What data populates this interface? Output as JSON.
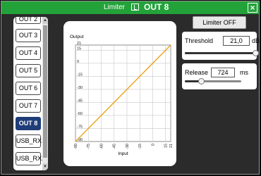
{
  "titlebar": {
    "label": "Limiter",
    "channel": "OUT 8",
    "close_icon": "×"
  },
  "channels": [
    {
      "label": "OUT 2",
      "active": false
    },
    {
      "label": "OUT 3",
      "active": false
    },
    {
      "label": "OUT 4",
      "active": false
    },
    {
      "label": "OUT 5",
      "active": false
    },
    {
      "label": "OUT 6",
      "active": false
    },
    {
      "label": "OUT 7",
      "active": false
    },
    {
      "label": "OUT 8",
      "active": true
    },
    {
      "label": "USB_RX1",
      "active": false
    },
    {
      "label": "USB_RX2",
      "active": false
    }
  ],
  "limiter_button": {
    "label": "Limiter OFF"
  },
  "threshold": {
    "label": "Threshold",
    "value": "21,0",
    "unit": "dBu",
    "fraction": 1.0
  },
  "release": {
    "label": "Release",
    "value": "724",
    "unit": "ms",
    "fraction": 0.29
  },
  "colors": {
    "title_bar": "#23a23a",
    "curve": "#e8a317",
    "active_channel": "#1f3d78"
  },
  "chart_data": {
    "type": "line",
    "ylabel": "Output",
    "xlabel": "Input",
    "xlim": [
      -90,
      21
    ],
    "ylim": [
      -90,
      21
    ],
    "yticks": [
      "21",
      "15",
      "0",
      "-15",
      "-30",
      "-45",
      "-60",
      "-75",
      "-90"
    ],
    "xticks": [
      "-90",
      "-75",
      "-60",
      "-45",
      "-30",
      "-15",
      "0",
      "15",
      "21"
    ],
    "series": [
      {
        "x": [
          -90,
          21
        ],
        "y": [
          -90,
          21
        ]
      }
    ]
  }
}
